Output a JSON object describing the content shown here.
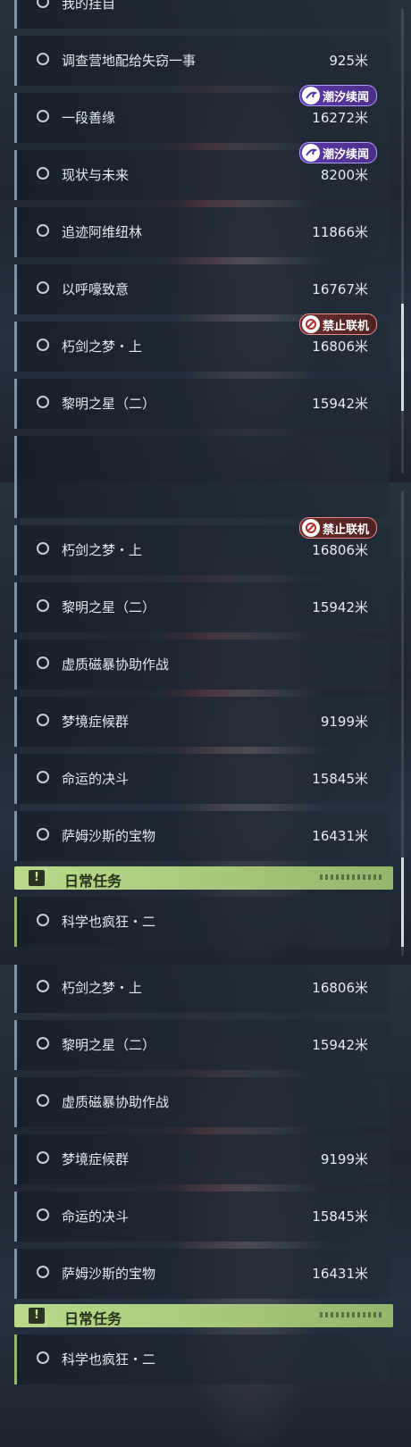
{
  "panel1": {
    "partial_top": "我的挂自",
    "rows": [
      {
        "name": "调查营地配给失窃一事",
        "distance": "925米"
      },
      {
        "name": "一段善缘",
        "distance": "16272米"
      },
      {
        "name": "现状与未来",
        "distance": "8200米"
      },
      {
        "name": "追迹阿维纽林",
        "distance": "11866米"
      },
      {
        "name": "以呼嚎致意",
        "distance": "16767米"
      },
      {
        "name": "朽剑之梦・上",
        "distance": "16806米"
      },
      {
        "name": "黎明之星（二）",
        "distance": "15942米"
      }
    ],
    "badge_tide": "潮汐续闻",
    "badge_no_coop": "禁止联机"
  },
  "panel2": {
    "rows": [
      {
        "name": "朽剑之梦・上",
        "distance": "16806米"
      },
      {
        "name": "黎明之星（二）",
        "distance": "15942米"
      },
      {
        "name": "虚质磁暴协助作战",
        "distance": ""
      },
      {
        "name": "梦境症候群",
        "distance": "9199米"
      },
      {
        "name": "命运的决斗",
        "distance": "15845米"
      },
      {
        "name": "萨姆沙斯的宝物",
        "distance": "16431米"
      }
    ],
    "badge_no_coop": "禁止联机",
    "section_title": "日常任务",
    "section_icon": "!",
    "daily_rows": [
      {
        "name": "科学也疯狂・二",
        "distance": ""
      }
    ]
  },
  "panel3": {
    "rows": [
      {
        "name": "朽剑之梦・上",
        "distance": "16806米"
      },
      {
        "name": "黎明之星（二）",
        "distance": "15942米"
      },
      {
        "name": "虚质磁暴协助作战",
        "distance": ""
      },
      {
        "name": "梦境症候群",
        "distance": "9199米"
      },
      {
        "name": "命运的决斗",
        "distance": "15845米"
      },
      {
        "name": "萨姆沙斯的宝物",
        "distance": "16431米"
      }
    ],
    "section_title": "日常任务",
    "section_icon": "!",
    "daily_rows": [
      {
        "name": "科学也疯狂・二",
        "distance": ""
      }
    ]
  },
  "colors": {
    "accent_green": "#b8d88a",
    "badge_purple": "#5a3aa8",
    "badge_red": "#6a2a2a",
    "row_border": "#7e93a8"
  },
  "icons": {
    "radio": "quest-radio-icon",
    "tide": "tide-swirl-icon",
    "no_coop": "no-coop-icon",
    "daily": "exclamation-icon"
  }
}
